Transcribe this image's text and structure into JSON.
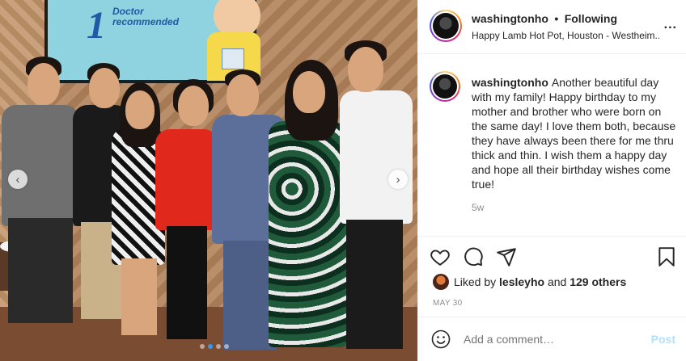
{
  "photo": {
    "poster": {
      "number": "1",
      "badge_text": "Doctor\nrecommended"
    },
    "nav": {
      "prev_icon": "chevron-left-icon",
      "next_icon": "chevron-right-icon"
    },
    "dots": {
      "count": 4,
      "active_index": 1
    }
  },
  "header": {
    "username": "washingtonho",
    "separator": "•",
    "follow_status": "Following",
    "location": "Happy Lamb Hot Pot, Houston - Westheim...",
    "more_icon": "more-options-icon",
    "more_label": "..."
  },
  "caption": {
    "username": "washingtonho",
    "text": "Another beautiful day with my family! Happy birthday to my mother and brother who were born on the same day! I love them both, because they have always been there for me thru thick and thin. I wish them a happy day and hope all their birthday wishes come true!",
    "time_ago": "5w"
  },
  "actions": {
    "like_icon": "heart-icon",
    "comment_icon": "comment-icon",
    "share_icon": "share-icon",
    "save_icon": "bookmark-icon"
  },
  "likes": {
    "prefix": "Liked by ",
    "user": "lesleyho",
    "middle": " and ",
    "others": "129 others"
  },
  "date": "MAY 30",
  "comment": {
    "emoji_icon": "emoji-icon",
    "placeholder": "Add a comment…",
    "post_label": "Post"
  },
  "colors": {
    "accent": "#3897f0",
    "post_disabled": "#b2dffc",
    "muted": "#8e8e8e"
  }
}
